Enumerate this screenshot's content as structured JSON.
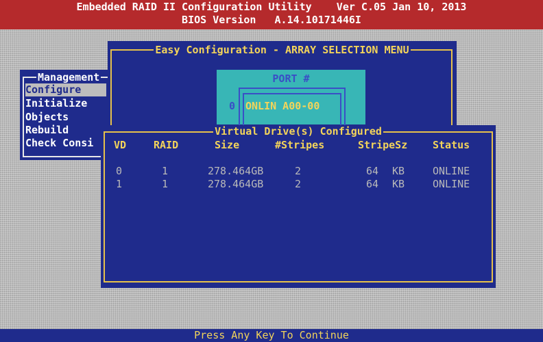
{
  "title_bar": {
    "line1": "Embedded RAID II Configuration Utility    Ver C.05 Jan 10, 2013",
    "line2": "BIOS Version   A.14.10171446I"
  },
  "management_menu": {
    "title": "Management",
    "items": [
      {
        "label": "Configure",
        "selected": true
      },
      {
        "label": "Initialize",
        "selected": false
      },
      {
        "label": "Objects",
        "selected": false
      },
      {
        "label": "Rebuild",
        "selected": false
      },
      {
        "label": "Check Consi",
        "selected": false
      }
    ]
  },
  "easy_config": {
    "title": "Easy Configuration - ARRAY SELECTION MENU"
  },
  "port_panel": {
    "title": "PORT #",
    "port_number": "0",
    "drive_status": "ONLIN A00-00"
  },
  "virtual_drives": {
    "title": "Virtual Drive(s) Configured",
    "headers": {
      "vd": "VD",
      "raid": "RAID",
      "size": "Size",
      "stripes": "#Stripes",
      "stripe_sz": "StripeSz",
      "status": "Status"
    },
    "rows": [
      {
        "vd": "0",
        "raid": "1",
        "size": "278.464GB",
        "stripes": "2",
        "stripe_sz": "64",
        "unit": "KB",
        "status": "ONLINE"
      },
      {
        "vd": "1",
        "raid": "1",
        "size": "278.464GB",
        "stripes": "2",
        "stripe_sz": "64",
        "unit": "KB",
        "status": "ONLINE"
      }
    ]
  },
  "status_bar": {
    "text": "Press Any Key To Continue"
  },
  "colors": {
    "title_bar_bg": "#b52a2c",
    "window_bg": "#1f2b8c",
    "port_bg": "#38b6b6",
    "highlight_text": "#f3d45a",
    "body_text": "#b9b9b9"
  }
}
